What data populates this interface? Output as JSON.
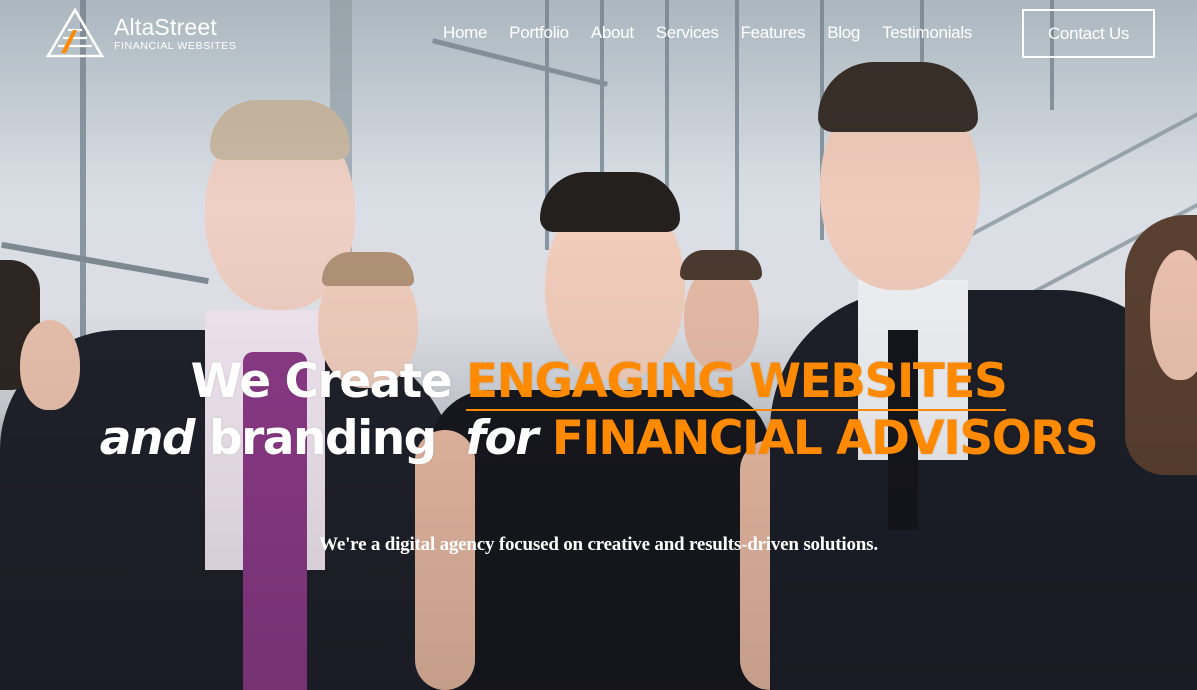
{
  "brand": {
    "name": "AltaStreet",
    "tagline": "FINANCIAL WEBSITES",
    "logo_icon": "triangle-a-logo-icon",
    "accent_color": "#ff8a00"
  },
  "nav": {
    "items": [
      {
        "label": "Home"
      },
      {
        "label": "Portfolio"
      },
      {
        "label": "About"
      },
      {
        "label": "Services"
      },
      {
        "label": "Features"
      },
      {
        "label": "Blog"
      },
      {
        "label": "Testimonials"
      }
    ],
    "cta_label": "Contact Us"
  },
  "hero": {
    "line1_white": "We Create",
    "line1_orange": "ENGAGING WEBSITES",
    "line2_italic_a": "and",
    "line2_white": "branding",
    "line2_italic_b": "for",
    "line2_orange": "FINANCIAL ADVISORS",
    "subtitle": "We're a digital agency focused on creative and results-driven solutions.",
    "background_image": "team-of-business-professionals-photo"
  }
}
